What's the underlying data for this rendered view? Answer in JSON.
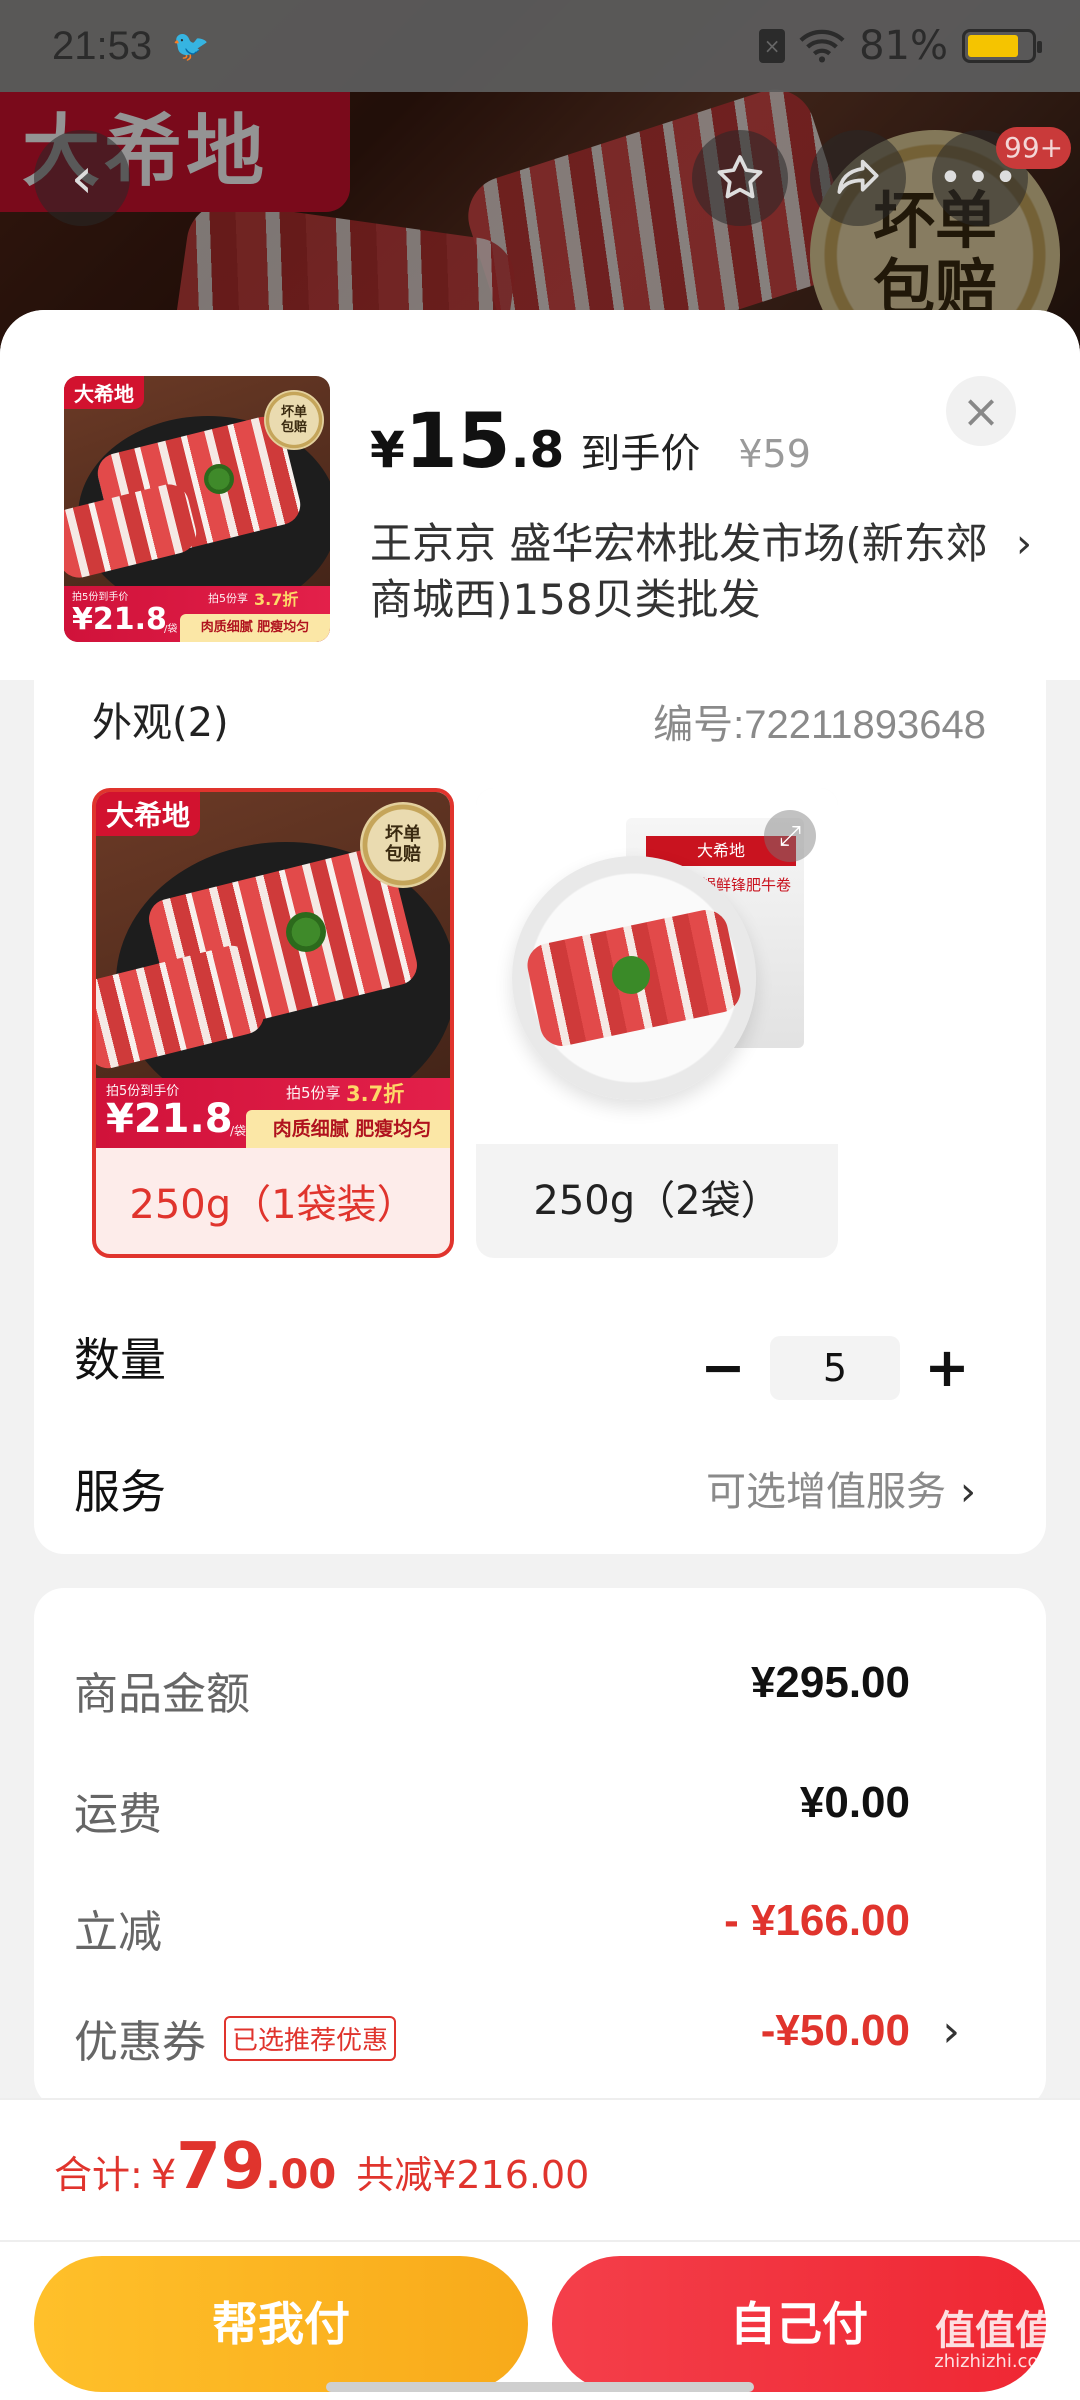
{
  "status_bar": {
    "time": "21:53",
    "battery": "81%",
    "battery_level": 0.81
  },
  "backdrop": {
    "brand": "大希地",
    "seal_text": "坏单包赔",
    "cart_badge": "99+"
  },
  "product": {
    "price_currency": "¥",
    "price_integer": "15",
    "price_decimal": ".8",
    "price_label": "到手价",
    "original_price": "¥59",
    "shop_name": "王京京  盛华宏林批发市场(新东郊商城西)158贝类批发"
  },
  "thumbnail": {
    "brand": "大希地",
    "seal": "坏单包赔",
    "bar_small_1": "拍5份到手价",
    "bar_small_2": "拍5份享",
    "bar_discount": "3.7折",
    "bar_price": "¥21.8",
    "bar_unit": "/袋",
    "tagline": "肉质细腻 肥瘦均匀"
  },
  "options": {
    "title": "外观(2)",
    "code": "编号:72211893648",
    "skus": [
      {
        "label": "250g（1袋装）",
        "selected": true
      },
      {
        "label": "250g（2袋）",
        "selected": false,
        "package_text": "火锅鲜锋肥牛卷",
        "brand": "大希地"
      }
    ],
    "quantity_label": "数量",
    "quantity_value": "5",
    "minus": "−",
    "plus": "+",
    "service_label": "服务",
    "service_link": "可选增值服务"
  },
  "price_breakdown": {
    "goods_label": "商品金额",
    "goods_value": "¥295.00",
    "shipping_label": "运费",
    "shipping_value": "¥0.00",
    "discount_label": "立减",
    "discount_value": "- ¥166.00",
    "coupon_label": "优惠券",
    "coupon_tag": "已选推荐优惠",
    "coupon_value": "-¥50.00"
  },
  "footer": {
    "total_label": "合计:",
    "total_currency": "¥",
    "total_integer": "79",
    "total_decimal": ".00",
    "total_savings": "共减¥216.00",
    "help_pay": "帮我付",
    "self_pay": "自己付"
  },
  "watermark": {
    "text": "值值值",
    "url": "zhizhizhi.com"
  },
  "colors": {
    "accent_red": "#e0342d",
    "brand_red": "#d2122f",
    "help_yellow": "#ffc02a",
    "self_red": "#ef2733"
  }
}
